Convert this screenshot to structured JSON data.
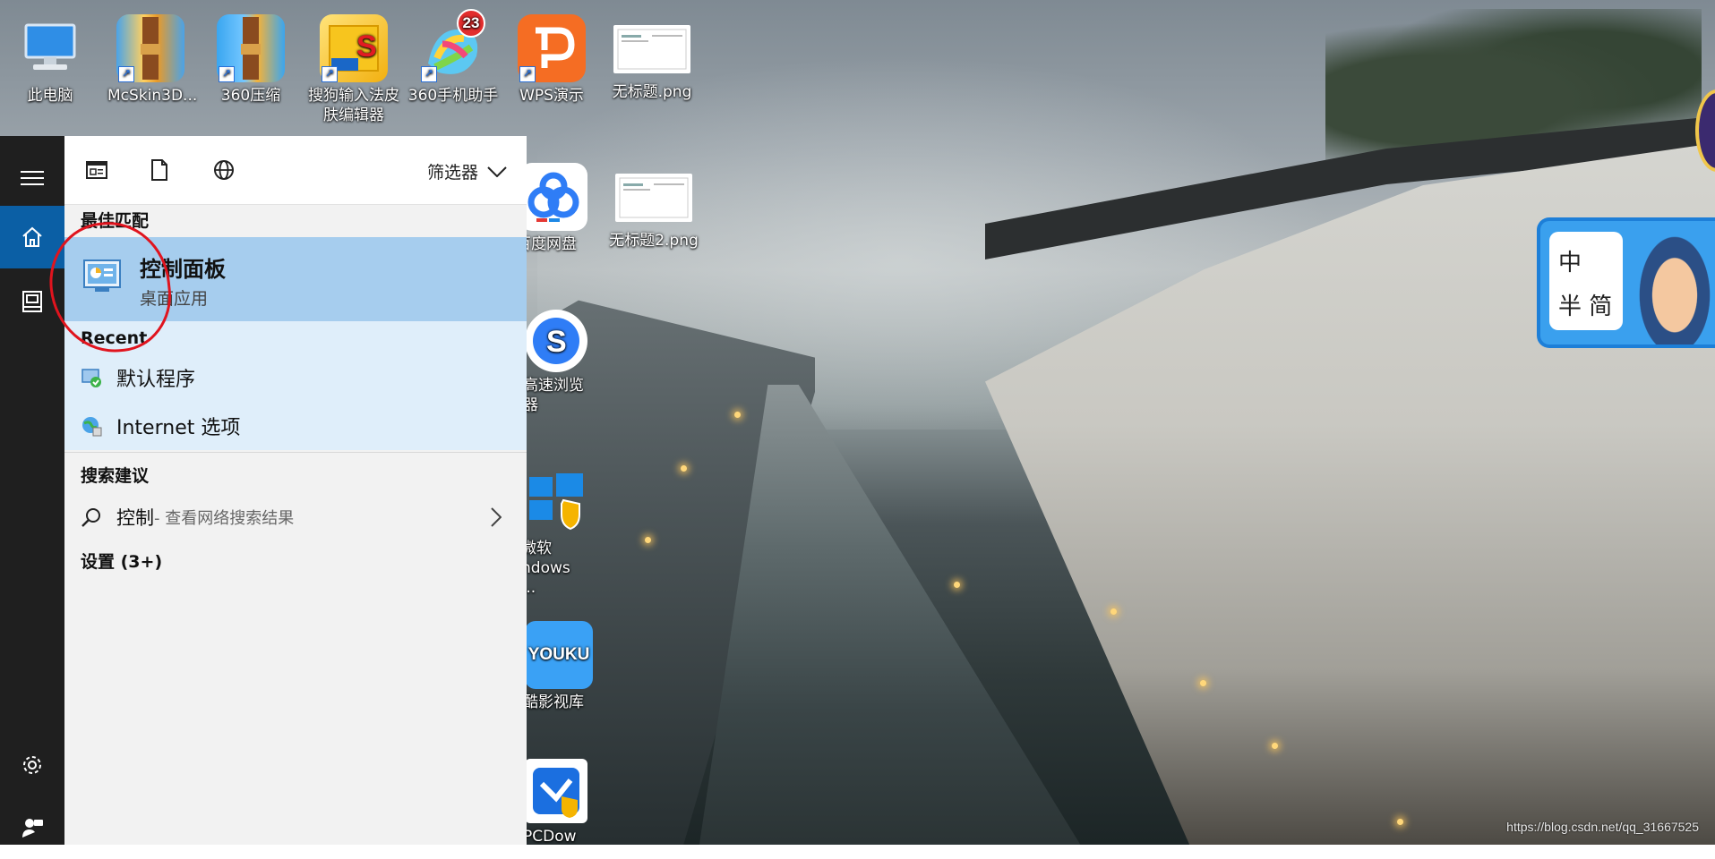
{
  "desktop": {
    "icons": [
      {
        "label": "此电脑",
        "icon": "computer-icon",
        "color": "#2f8ee6"
      },
      {
        "label": "McSkin3D...",
        "icon": "winrar-icon",
        "color": "#e0a030"
      },
      {
        "label": "360压缩",
        "icon": "archive-360-icon",
        "color": "#2b9cf2"
      },
      {
        "label": "搜狗输入法皮肤编辑器",
        "icon": "sogou-skin-icon",
        "color": "#f5c218"
      },
      {
        "label": "360手机助手",
        "icon": "360-phone-icon",
        "color": "#4bc1f0",
        "badge": "23"
      },
      {
        "label": "WPS演示",
        "icon": "wps-icon",
        "color": "#f56d23"
      },
      {
        "label": "无标题.png",
        "icon": "image-file-icon",
        "color": "#ffffff"
      },
      {
        "label": "百度网盘",
        "icon": "baidu-pan-icon",
        "color": "#2f7df6"
      },
      {
        "label": "无标题2.png",
        "icon": "image-file-icon",
        "color": "#ffffff"
      },
      {
        "label": "高速浏览器",
        "icon": "sogou-browser-icon",
        "color": "#2f7df6"
      },
      {
        "label": "微软 ndows ...",
        "icon": "windows-security-icon",
        "color": "#1b8ae6"
      },
      {
        "label": "酷影视库",
        "icon": "youku-icon",
        "color": "#2f9df5",
        "glyph_text": "YOUKU"
      },
      {
        "label": "PCDow",
        "icon": "pc-download-icon",
        "color": "#1b6fe0"
      }
    ],
    "watermark": "https://blog.csdn.net/qq_31667525"
  },
  "start": {
    "rail": {
      "menu": "hamburger-icon",
      "home": "home-icon",
      "notebook": "notebook-icon",
      "settings": "gear-icon",
      "feedback": "feedback-icon"
    },
    "header": {
      "filters_label": "筛选器"
    },
    "best_match": {
      "heading": "最佳匹配",
      "title": "控制面板",
      "subtitle": "桌面应用"
    },
    "recent": {
      "heading": "Recent",
      "items": [
        {
          "label": "默认程序"
        },
        {
          "label": "Internet 选项"
        }
      ]
    },
    "suggestions": {
      "heading": "搜索建议",
      "query": "控制",
      "hint": " - 查看网络搜索结果"
    },
    "settings_heading": "设置 (3+)"
  },
  "widget": {
    "line1": "中",
    "line2": "半 简"
  }
}
